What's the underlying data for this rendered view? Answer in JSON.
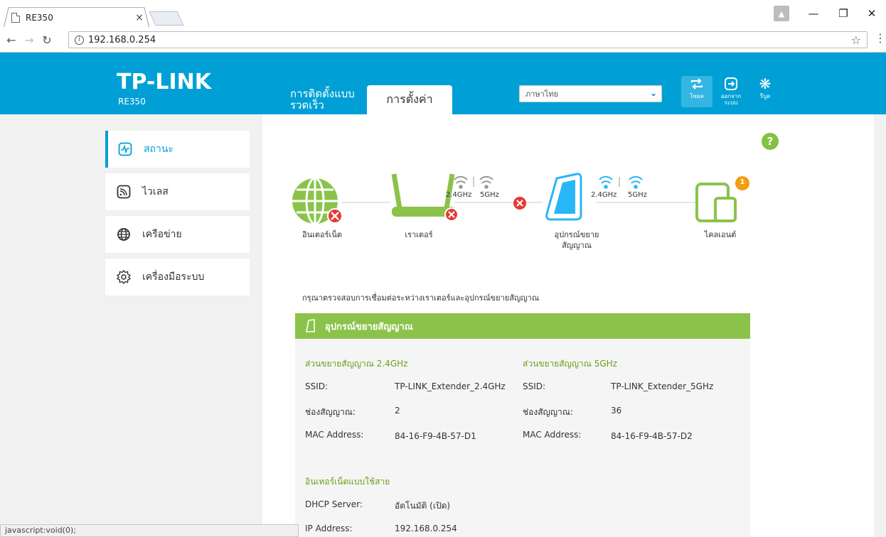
{
  "browser": {
    "tab_title": "RE350",
    "tab_close": "×",
    "url": "192.168.0.254",
    "status_text": "javascript:void(0);"
  },
  "header": {
    "logo": "TP-LINK",
    "model": "RE350",
    "quick_setup": "การติดตั้งแบบรวดเร็ว",
    "settings": "การตั้งค่า",
    "language": "ภาษาไทย",
    "reboot_label": "โหมด",
    "logout_label": "ออกจากระบบ",
    "reset_label": "รีบูต"
  },
  "sidebar": {
    "items": [
      {
        "label": "สถานะ"
      },
      {
        "label": "ไวเลส"
      },
      {
        "label": "เครือข่าย"
      },
      {
        "label": "เครื่องมือระบบ"
      }
    ]
  },
  "topology": {
    "internet": "อินเตอร์เน็ต",
    "router": "เราเตอร์",
    "extender_line1": "อุปกรณ์ขยาย",
    "extender_line2": "สัญญาณ",
    "clients": "ไคลเอนต์",
    "band_24": "2.4GHz",
    "band_5": "5GHz",
    "client_count": "1"
  },
  "message": "กรุณาตรวจสอบการเชื่อมต่อระหว่างเราเตอร์และอุปกรณ์ขยายสัญญาณ",
  "extender": {
    "title": "อุปกรณ์ขยายสัญญาณ",
    "band24": {
      "title": "ส่วนขยายสัญญาณ 2.4GHz",
      "ssid_label": "SSID:",
      "ssid": "TP-LINK_Extender_2.4GHz",
      "channel_label": "ช่องสัญญาณ:",
      "channel": "2",
      "mac_label": "MAC Address:",
      "mac": "84-16-F9-4B-57-D1"
    },
    "band5": {
      "title": "ส่วนขยายสัญญาณ 5GHz",
      "ssid_label": "SSID:",
      "ssid": "TP-LINK_Extender_5GHz",
      "channel_label": "ช่องสัญญาณ:",
      "channel": "36",
      "mac_label": "MAC Address:",
      "mac": "84-16-F9-4B-57-D2"
    },
    "wired": {
      "title": "อินเทอร์เน็ตแบบใช้สาย",
      "dhcp_label": "DHCP Server:",
      "dhcp": "อัตโนมัติ (เปิด)",
      "ip_label": "IP Address:",
      "ip": "192.168.0.254"
    }
  },
  "colors": {
    "header_blue": "#00a0d6",
    "green": "#8bc34a",
    "error_red": "#e53935",
    "badge_orange": "#f39c12"
  }
}
